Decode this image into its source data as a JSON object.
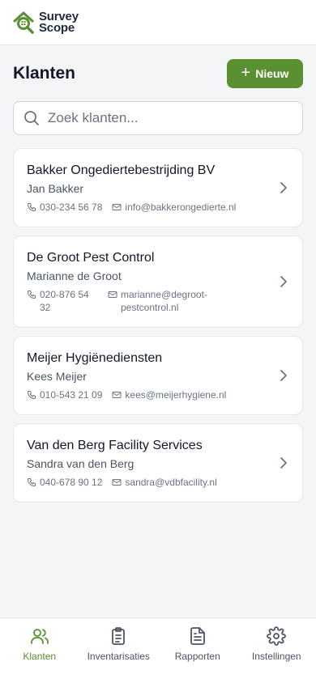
{
  "brand": {
    "line1": "Survey",
    "line2": "Scope",
    "accent": "#5a8f32"
  },
  "page": {
    "title": "Klanten",
    "new_label": "Nieuw"
  },
  "search": {
    "placeholder": "Zoek klanten..."
  },
  "clients": [
    {
      "company": "Bakker Ongediertebestrijding BV",
      "contact": "Jan Bakker",
      "phone": "030-234 56 78",
      "email": "info@bakkerongedierte.nl"
    },
    {
      "company": "De Groot Pest Control",
      "contact": "Marianne de Groot",
      "phone": "020-876 54 32",
      "email": "marianne@degroot-pestcontrol.nl"
    },
    {
      "company": "Meijer Hygiënediensten",
      "contact": "Kees Meijer",
      "phone": "010-543 21 09",
      "email": "kees@meijerhygiene.nl"
    },
    {
      "company": "Van den Berg Facility Services",
      "contact": "Sandra van den Berg",
      "phone": "040-678 90 12",
      "email": "sandra@vdbfacility.nl"
    }
  ],
  "tabs": [
    {
      "label": "Klanten",
      "icon": "users-icon",
      "active": true
    },
    {
      "label": "Inventarisaties",
      "icon": "clipboard-icon",
      "active": false
    },
    {
      "label": "Rapporten",
      "icon": "document-icon",
      "active": false
    },
    {
      "label": "Instellingen",
      "icon": "gear-icon",
      "active": false
    }
  ]
}
